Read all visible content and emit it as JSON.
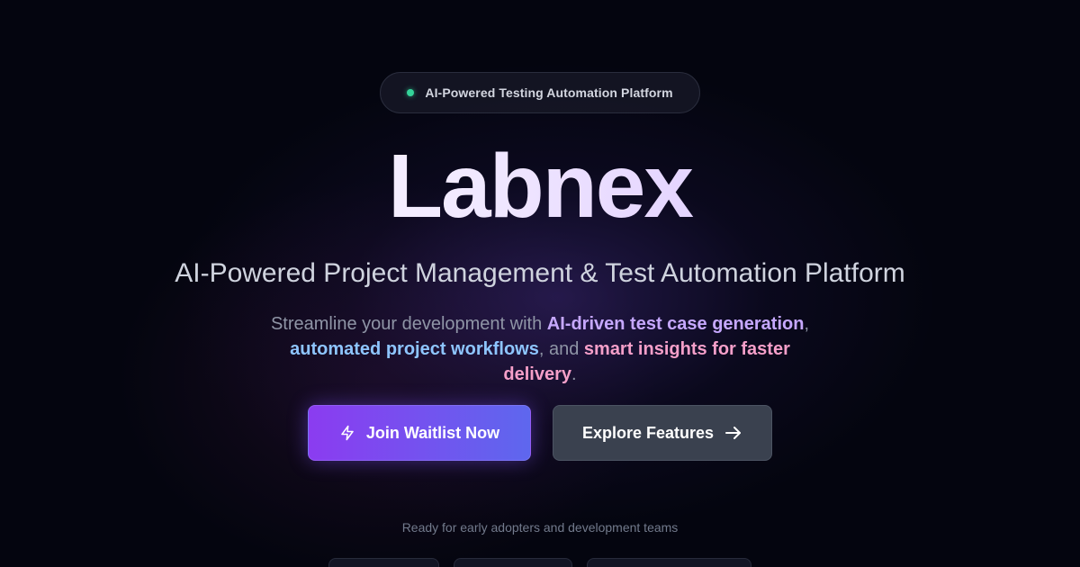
{
  "badge": {
    "text": "AI-Powered Testing Automation Platform",
    "dot_color": "#34d399"
  },
  "hero": {
    "title": "Labnex",
    "subtitle": "AI-Powered Project Management & Test Automation Platform",
    "description": {
      "part1": "Streamline your development with ",
      "highlight1": "AI-driven test case generation",
      "sep1": ", ",
      "highlight2": "automated project workflows",
      "part2": ", and ",
      "highlight3": "smart insights for faster delivery",
      "end": "."
    }
  },
  "buttons": {
    "primary": {
      "label": "Join Waitlist Now",
      "icon": "lightning-icon"
    },
    "secondary": {
      "label": "Explore Features",
      "icon": "arrow-right-icon"
    }
  },
  "footer": {
    "note": "Ready for early adopters and development teams"
  },
  "colors": {
    "background": "#04050f",
    "primary_gradient_start": "#8b3cf0",
    "primary_gradient_end": "#5e67ee",
    "highlight_purple": "#c6a8ff",
    "highlight_blue": "#8ec5ff",
    "highlight_pink": "#f59fc9"
  }
}
